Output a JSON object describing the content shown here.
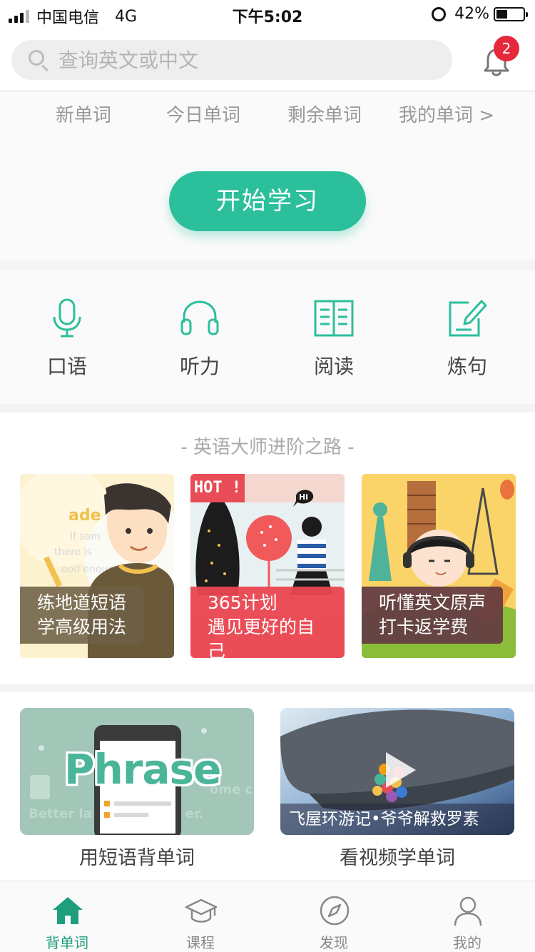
{
  "status_bar": {
    "carrier": "中国电信",
    "network": "4G",
    "time": "下午5:02",
    "battery": "42%",
    "battery_level": 0.42
  },
  "search": {
    "placeholder": "查询英文或中文"
  },
  "notifications": {
    "count": "2"
  },
  "word_stats": {
    "new_words": "新单词",
    "today_words": "今日单词",
    "remaining_words": "剩余单词",
    "my_words": "我的单词 >"
  },
  "start_button": "开始学习",
  "skills": [
    {
      "label": "口语",
      "icon": "microphone-icon"
    },
    {
      "label": "听力",
      "icon": "headphones-icon"
    },
    {
      "label": "阅读",
      "icon": "book-icon"
    },
    {
      "label": "炼句",
      "icon": "edit-icon"
    }
  ],
  "courses": {
    "title": "- 英语大师进阶之路 -",
    "items": [
      {
        "line1": "练地道短语",
        "line2": "学高级用法"
      },
      {
        "badge": "HOT !",
        "line1": "365计划",
        "line2": "遇见更好的自己"
      },
      {
        "line1": "听懂英文原声",
        "line2": "打卡返学费"
      }
    ]
  },
  "videos": [
    {
      "title": "Phrase",
      "caption": "用短语背单词"
    },
    {
      "overlay": "飞屋环游记•爷爷解救罗素",
      "caption": "看视频学单词"
    }
  ],
  "tabbar": [
    {
      "label": "背单词",
      "active": true,
      "icon": "home-icon"
    },
    {
      "label": "课程",
      "active": false,
      "icon": "graduation-cap-icon"
    },
    {
      "label": "发现",
      "active": false,
      "icon": "compass-icon"
    },
    {
      "label": "我的",
      "active": false,
      "icon": "user-icon"
    }
  ],
  "colors": {
    "accent": "#2cbf9c",
    "badge": "#e5283a",
    "tab_active": "#1f9e7d"
  }
}
